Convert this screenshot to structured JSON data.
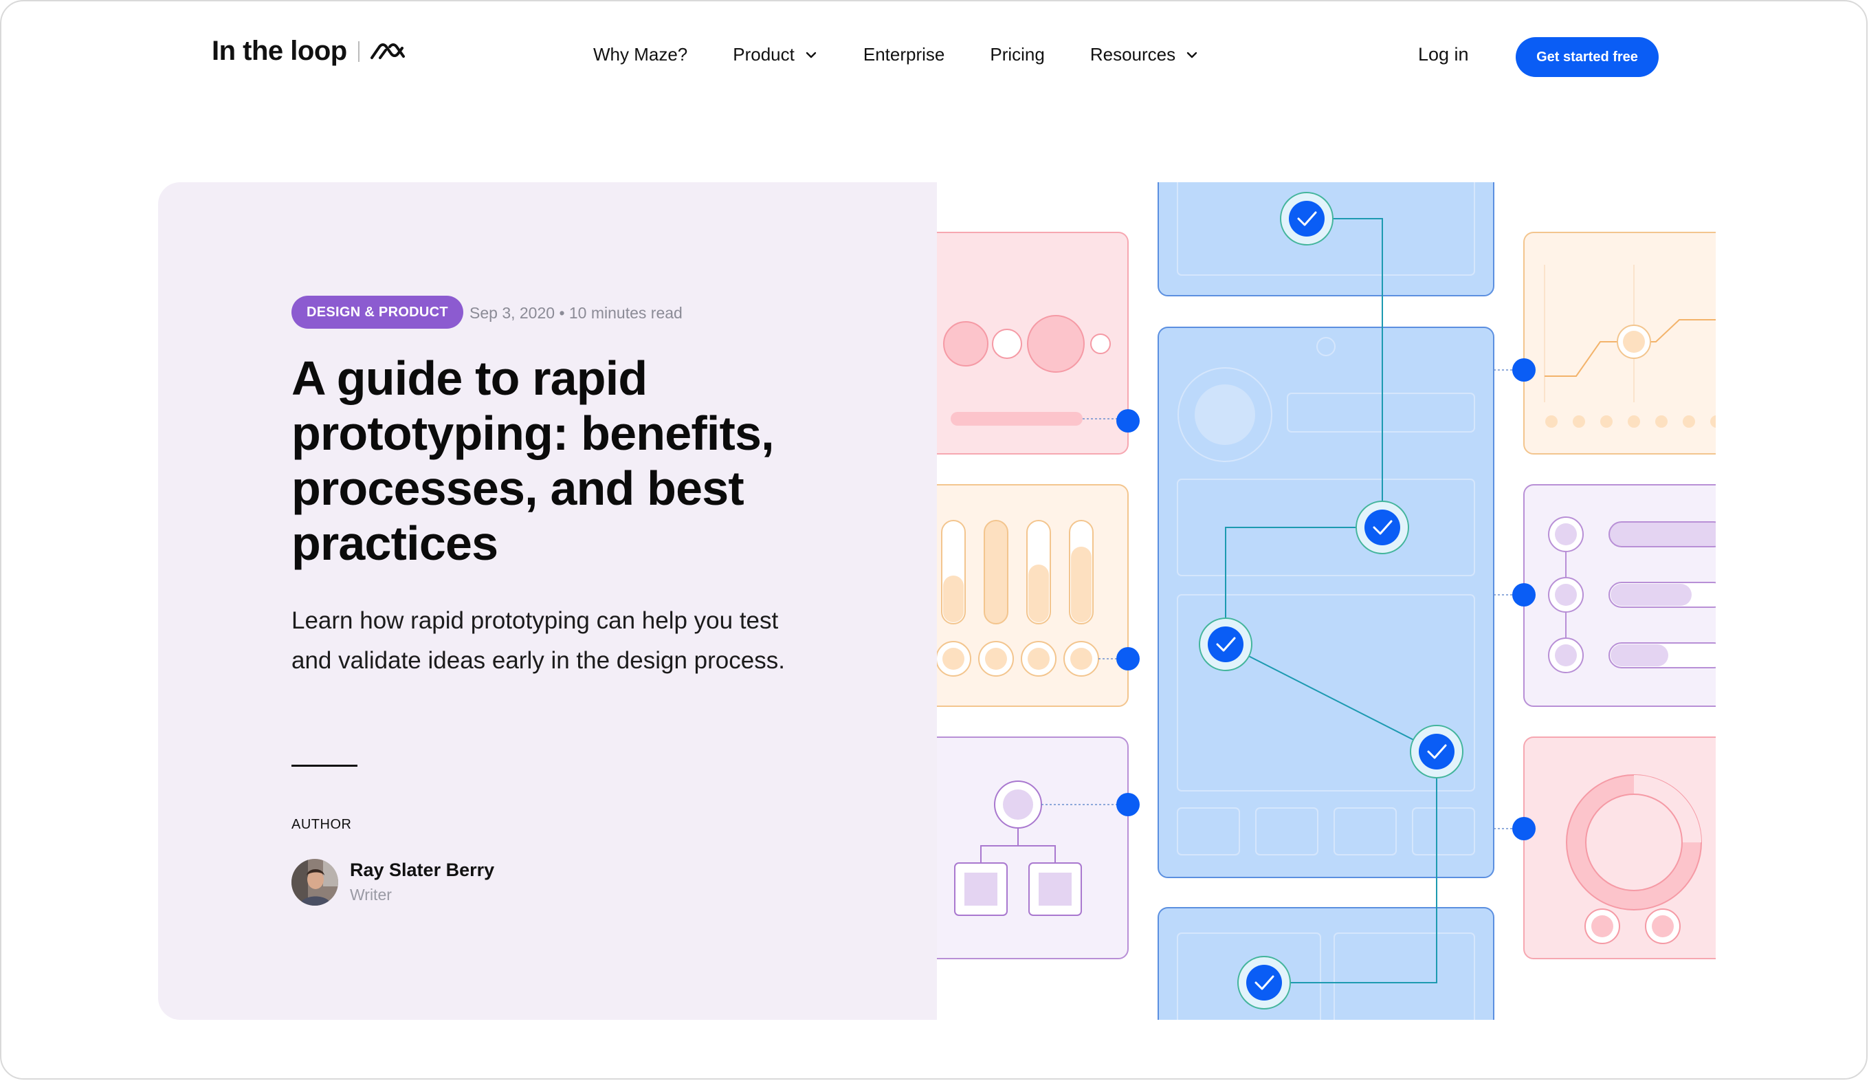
{
  "header": {
    "logo_text": "In the loop",
    "nav": [
      {
        "label": "Why Maze?",
        "dropdown": false
      },
      {
        "label": "Product",
        "dropdown": true
      },
      {
        "label": "Enterprise",
        "dropdown": false
      },
      {
        "label": "Pricing",
        "dropdown": false
      },
      {
        "label": "Resources",
        "dropdown": true
      }
    ],
    "login_label": "Log in",
    "cta_label": "Get started free"
  },
  "article": {
    "category": "DESIGN & PRODUCT",
    "meta": "Sep 3, 2020 • 10 minutes read",
    "title": "A guide to rapid prototyping: benefits, processes, and best practices",
    "lede": "Learn how rapid prototyping can help you test and validate ideas early in the design process.",
    "author_label": "AUTHOR",
    "author_name": "Ray Slater Berry",
    "author_role": "Writer"
  },
  "colors": {
    "accent_blue": "#0a5df5",
    "badge_purple": "#8c5bd0",
    "hero_bg": "#f3eef7",
    "illus_blue": "#bcd9fb",
    "illus_pink": "#fde3e7",
    "illus_peach": "#fff3e8",
    "illus_lilac": "#f5f0fb"
  }
}
